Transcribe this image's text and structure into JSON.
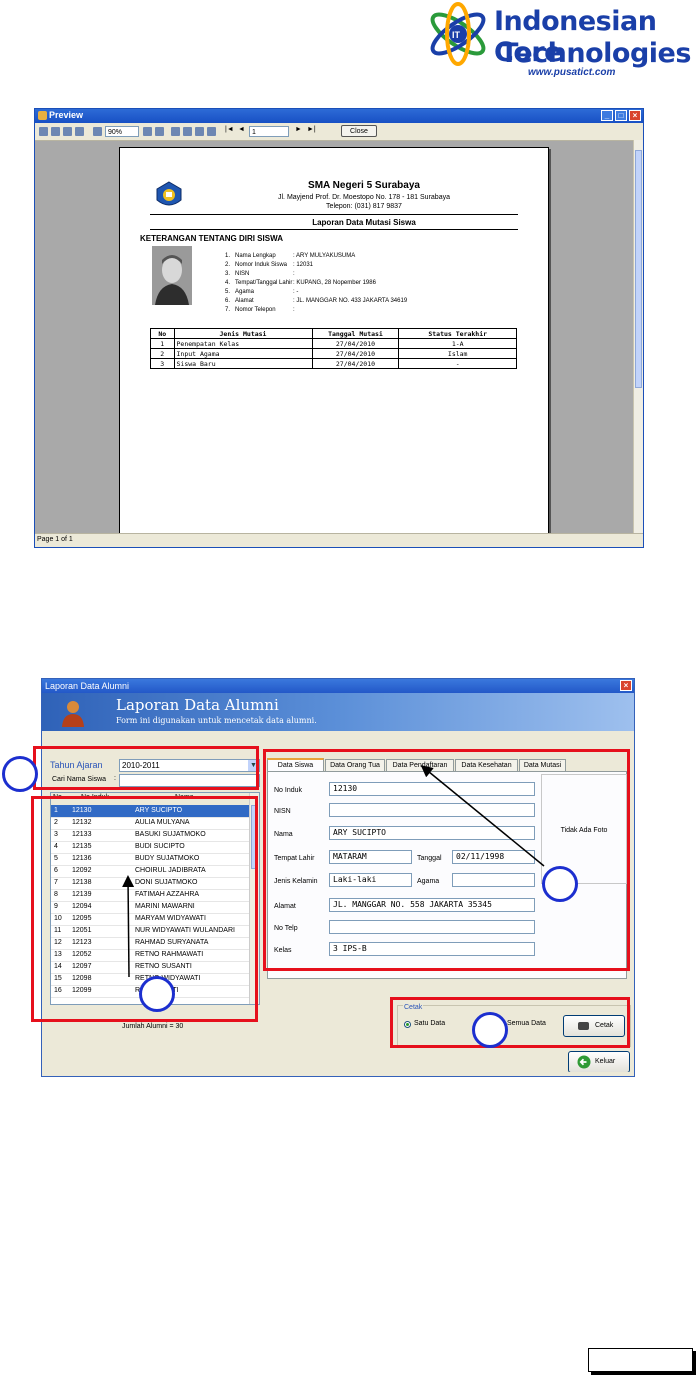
{
  "logo": {
    "line1": "Indonesian Core",
    "line2": "Technologies",
    "url": "www.pusatict.com"
  },
  "preview_window": {
    "title": "Preview",
    "zoom": "90%",
    "page_input": "1",
    "close_label": "Close",
    "status": "Page 1 of 1"
  },
  "report": {
    "school_name": "SMA Negeri 5 Surabaya",
    "address": "Jl. Mayjend Prof. Dr. Moestopo No. 178 - 181 Surabaya",
    "phone": "Telepon: (031) 817 9837",
    "title": "Laporan Data Mutasi Siswa",
    "section": "KETERANGAN TENTANG DIRI SISWA",
    "fields": [
      {
        "no": "1.",
        "label": "Nama Lengkap",
        "value": ": ARY MULYAKUSUMA"
      },
      {
        "no": "2.",
        "label": "Nomor Induk Siswa",
        "value": ": 12031"
      },
      {
        "no": "3.",
        "label": "NISN",
        "value": ":"
      },
      {
        "no": "4.",
        "label": "Tempat/Tanggal Lahir",
        "value": ": KUPANG, 28 Nopember 1986"
      },
      {
        "no": "5.",
        "label": "Agama",
        "value": ": -"
      },
      {
        "no": "6.",
        "label": "Alamat",
        "value": ": JL. MANGGAR NO. 433 JAKARTA 34619"
      },
      {
        "no": "7.",
        "label": "Nomor Telepon",
        "value": ":"
      }
    ],
    "table_headers": [
      "No",
      "Jenis Mutasi",
      "Tanggal Mutasi",
      "Status Terakhir"
    ],
    "table_rows": [
      [
        "1",
        "Penempatan Kelas",
        "27/04/2010",
        "1-A"
      ],
      [
        "2",
        "Input Agama",
        "27/04/2010",
        "Islam"
      ],
      [
        "3",
        "Siswa Baru",
        "27/04/2010",
        "-"
      ]
    ]
  },
  "alumni_window": {
    "title": "Laporan Data Alumni",
    "header_title": "Laporan Data Alumni",
    "header_subtitle": "Form ini digunakan untuk mencetak data alumni.",
    "tahun_ajaran_label": "Tahun Ajaran",
    "tahun_ajaran_value": "2010-2011",
    "cari_label": "Cari Nama Siswa",
    "grid_headers": [
      "No",
      "No Induk",
      "Nama"
    ],
    "grid_rows": [
      [
        "1",
        "12130",
        "ARY SUCIPTO"
      ],
      [
        "2",
        "12132",
        "AULIA MULYANA"
      ],
      [
        "3",
        "12133",
        "BASUKI SUJATMOKO"
      ],
      [
        "4",
        "12135",
        "BUDI SUCIPTO"
      ],
      [
        "5",
        "12136",
        "BUDY SUJATMOKO"
      ],
      [
        "6",
        "12092",
        "CHOIRUL JADIBRATA"
      ],
      [
        "7",
        "12138",
        "DONI SUJATMOKO"
      ],
      [
        "8",
        "12139",
        "FATIMAH AZZAHRA"
      ],
      [
        "9",
        "12094",
        "MARINI MAWARNI"
      ],
      [
        "10",
        "12095",
        "MARYAM WIDYAWATI"
      ],
      [
        "11",
        "12051",
        "NUR WIDYAWATI WULANDARI"
      ],
      [
        "12",
        "12123",
        "RAHMAD SURYANATA"
      ],
      [
        "13",
        "12052",
        "RETNO RAHMAWATI"
      ],
      [
        "14",
        "12097",
        "RETNO SUSANTI"
      ],
      [
        "15",
        "12098",
        "RETNO WIDYAWATI"
      ],
      [
        "16",
        "12099",
        "RIA SUSANTI"
      ]
    ],
    "jumlah": "Jumlah Alumni = 30",
    "tabs": [
      "Data Siswa",
      "Data Orang Tua",
      "Data Pendaftaran",
      "Data Kesehatan",
      "Data Mutasi"
    ],
    "form": {
      "no_induk_label": "No Induk",
      "no_induk": "12130",
      "nisn_label": "NISN",
      "nisn": "",
      "nama_label": "Nama",
      "nama": "ARY SUCIPTO",
      "tempat_label": "Tempat Lahir",
      "tempat": "MATARAM",
      "tanggal_label": "Tanggal",
      "tanggal": "02/11/1998",
      "jk_label": "Jenis Kelamin",
      "jk": "Laki-laki",
      "agama_label": "Agama",
      "agama": "",
      "alamat_label": "Alamat",
      "alamat": "JL. MANGGAR NO. 558 JAKARTA 35345",
      "telp_label": "No Telp",
      "telp": "",
      "kelas_label": "Kelas",
      "kelas": "3 IPS-B"
    },
    "photo_placeholder": "Tidak Ada Foto",
    "cetak_group_label": "Cetak",
    "radio_satu": "Satu Data",
    "radio_semua": "Semua Data",
    "cetak_button": "Cetak",
    "keluar_button": "Keluar"
  },
  "colors": {
    "annotation_red": "#e6101c",
    "annotation_blue": "#1c2fcf",
    "xp_blue": "#2358c8",
    "selection": "#316ac5"
  }
}
